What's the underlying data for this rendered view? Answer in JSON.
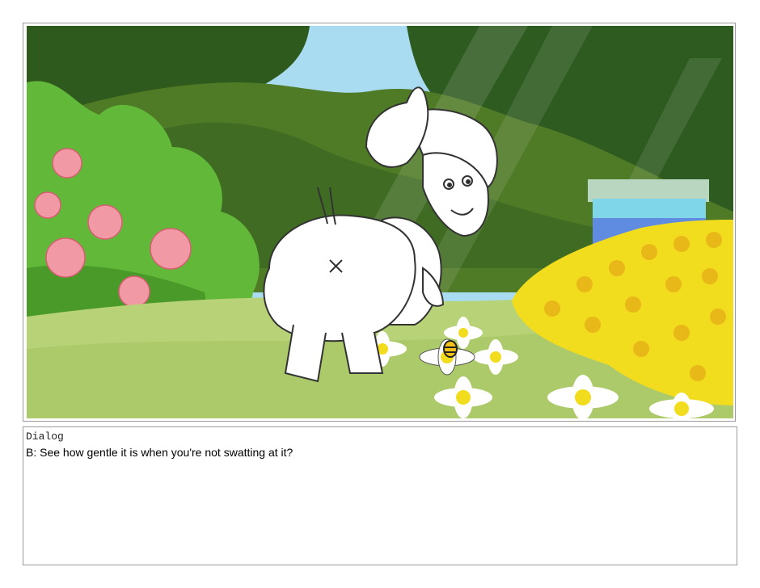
{
  "panel": {
    "colors": {
      "sky": "#a9dcf0",
      "foliage_dark": "#2f5a1e",
      "foliage_mid": "#6f9a34",
      "bush_green": "#62b838",
      "rose_pink": "#f19aa6",
      "grass_light": "#b8d277",
      "marigold_yellow": "#f2dc1e",
      "beehive_blue": "#5f8be0",
      "beehive_teal": "#7fd6e8"
    }
  },
  "dialog": {
    "label": "Dialog",
    "text": "B: See how gentle it is when you're not swatting at it?"
  }
}
